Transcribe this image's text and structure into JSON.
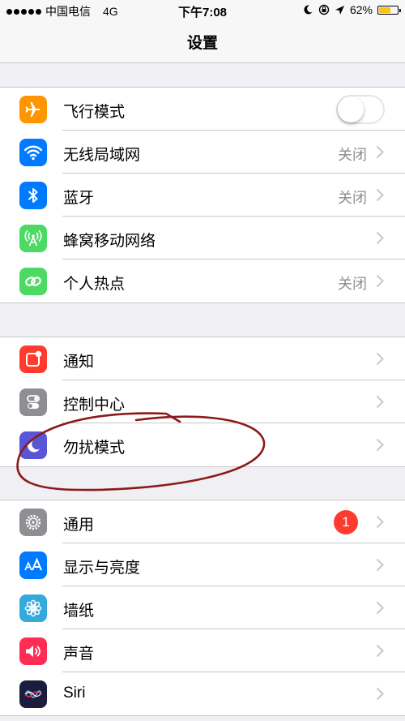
{
  "status_bar": {
    "carrier": "中国电信",
    "network": "4G",
    "time": "下午7:08",
    "battery": "62%",
    "battery_level": 0.62,
    "battery_color": "#f5c518",
    "icons": [
      "moon-icon",
      "rotation-lock-icon",
      "location-arrow-icon"
    ]
  },
  "nav": {
    "title": "设置"
  },
  "group1": {
    "items": [
      {
        "label": "飞行模式",
        "icon": "airplane-icon",
        "color": "#ff9500",
        "toggle": false
      },
      {
        "label": "无线局域网",
        "value": "关闭",
        "icon": "wifi-icon",
        "color": "#007aff"
      },
      {
        "label": "蓝牙",
        "value": "关闭",
        "icon": "bluetooth-icon",
        "color": "#007aff"
      },
      {
        "label": "蜂窝移动网络",
        "icon": "cellular-antenna-icon",
        "color": "#4cd964"
      },
      {
        "label": "个人热点",
        "value": "关闭",
        "icon": "hotspot-link-icon",
        "color": "#4cd964"
      }
    ]
  },
  "group2": {
    "items": [
      {
        "label": "通知",
        "icon": "notifications-icon",
        "color": "#ff3b30"
      },
      {
        "label": "控制中心",
        "icon": "control-center-icon",
        "color": "#8e8e93"
      },
      {
        "label": "勿扰模式",
        "icon": "moon-icon",
        "color": "#5856d6"
      }
    ]
  },
  "group3": {
    "items": [
      {
        "label": "通用",
        "badge": "1",
        "icon": "gear-icon",
        "color": "#8e8e93"
      },
      {
        "label": "显示与亮度",
        "icon": "text-size-icon",
        "color": "#007aff"
      },
      {
        "label": "墙纸",
        "icon": "flower-icon",
        "color": "#34aadc"
      },
      {
        "label": "声音",
        "icon": "speaker-icon",
        "color": "#ff2d55"
      },
      {
        "label": "Siri",
        "icon": "siri-icon",
        "color": "#1c1c3c"
      }
    ]
  },
  "annotation": {
    "color": "#8b1a1a",
    "shape": "hand-drawn ellipse around 勿扰模式"
  }
}
